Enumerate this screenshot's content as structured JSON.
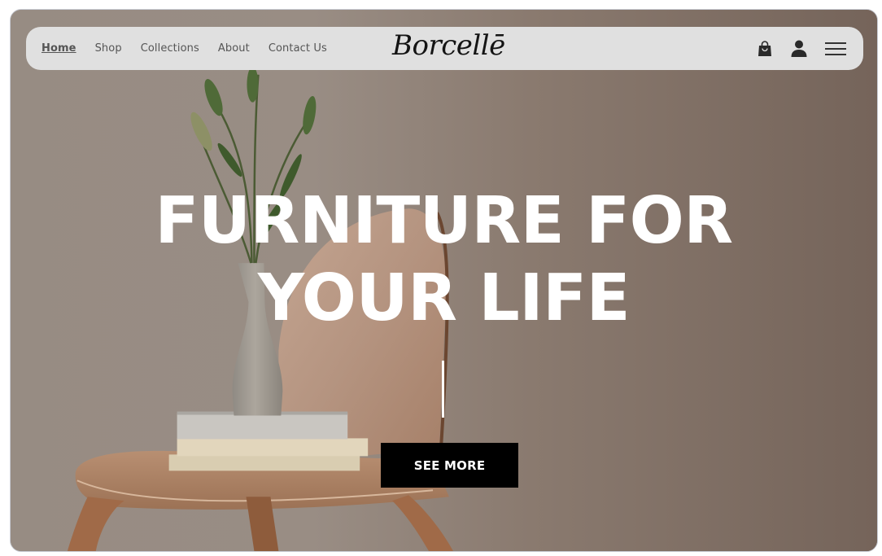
{
  "nav": {
    "links": [
      {
        "label": "Home",
        "active": true
      },
      {
        "label": "Shop",
        "active": false
      },
      {
        "label": "Collections",
        "active": false
      },
      {
        "label": "About",
        "active": false
      },
      {
        "label": "Contact Us",
        "active": false
      }
    ],
    "logo": "Borcellē",
    "icons": [
      "shopping-bag-icon",
      "user-icon",
      "hamburger-menu-icon"
    ]
  },
  "hero": {
    "title_line1": "FURNITURE FOR",
    "title_line2": "YOUR LIFE",
    "cta_label": "SEE MORE",
    "background_image": "vase with lily buds on stacked books atop a plywood chair"
  },
  "colors": {
    "navbar_bg": "#e0e0e0",
    "nav_text": "#555555",
    "logo": "#141414",
    "hero_text": "#ffffff",
    "cta_bg": "#000000",
    "cta_text": "#ffffff",
    "backdrop": "#8c7d71"
  }
}
